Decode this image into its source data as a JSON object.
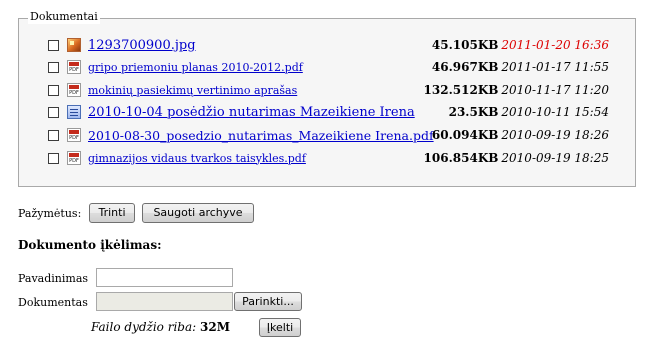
{
  "documents": {
    "legend": "Dokumentai",
    "files": [
      {
        "icon": "image-file-icon",
        "name": "1293700900.jpg",
        "size": "45.105KB",
        "date": "2011-01-20 16:36",
        "date_highlight": true
      },
      {
        "icon": "pdf-file-icon",
        "name": "gripo priemoniu planas 2010-2012.pdf",
        "size": "46.967KB",
        "date": "2011-01-17 11:55",
        "date_highlight": false
      },
      {
        "icon": "pdf-file-icon",
        "name": "mokinių pasiekimų vertinimo aprašas",
        "size": "132.512KB",
        "date": "2010-11-17 11:20",
        "date_highlight": false
      },
      {
        "icon": "word-file-icon",
        "name": "2010-10-04 posėdžio nutarimas Mazeikiene Irena",
        "size": "23.5KB",
        "date": "2010-10-11 15:54",
        "date_highlight": false
      },
      {
        "icon": "pdf-file-icon",
        "name": "2010-08-30_posedzio_nutarimas_Mazeikiene Irena.pdf",
        "size": "60.094KB",
        "date": "2010-09-19 18:26",
        "date_highlight": false
      },
      {
        "icon": "pdf-file-icon",
        "name": "gimnazijos vidaus tvarkos taisykles.pdf",
        "size": "106.854KB",
        "date": "2010-09-19 18:25",
        "date_highlight": false
      }
    ]
  },
  "selection": {
    "label": "Pažymėtus:",
    "delete_label": "Trinti",
    "archive_label": "Saugoti archyve"
  },
  "upload": {
    "heading": "Dokumento įkėlimas:",
    "name_label": "Pavadinimas",
    "name_value": "",
    "file_label": "Dokumentas",
    "file_value": "",
    "browse_label": "Parinkti...",
    "limit_label": "Failo dydžio riba:",
    "limit_value": "32M",
    "submit_label": "Įkelti"
  },
  "colors": {
    "link": "#0000cc",
    "highlight_date": "#dd0000",
    "fieldset_bg": "#f6f6f6"
  }
}
